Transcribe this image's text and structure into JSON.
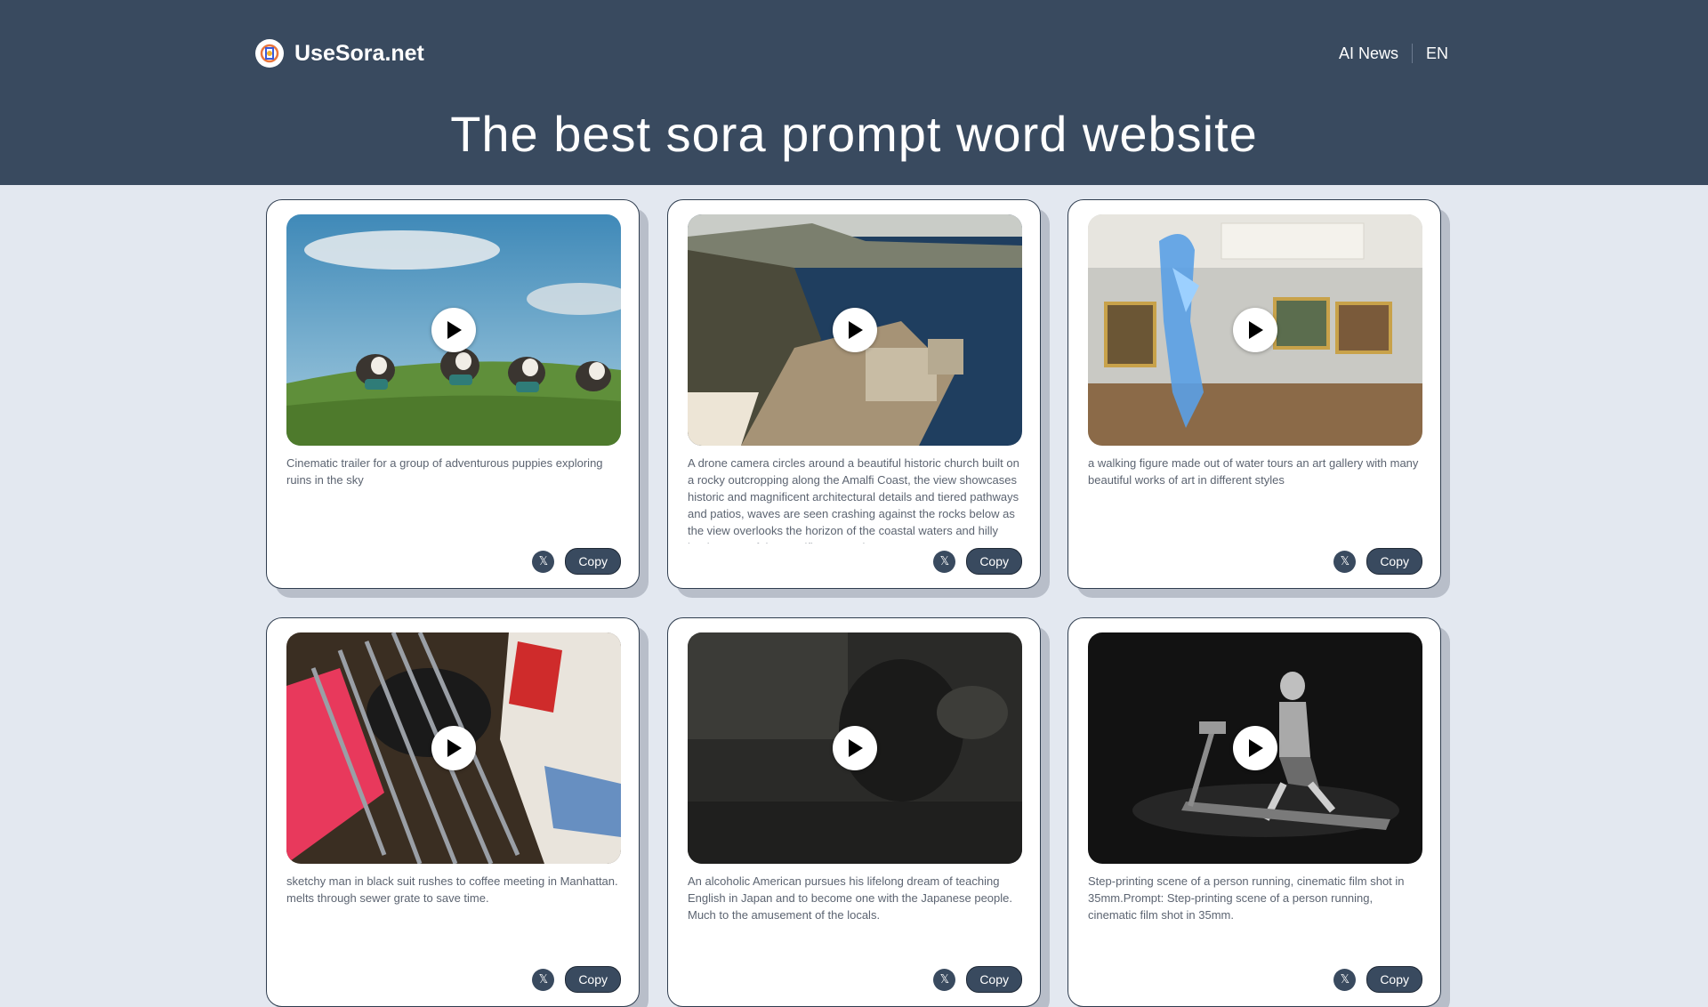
{
  "site": {
    "name": "UseSora.net"
  },
  "nav": {
    "items": [
      "AI News",
      "EN"
    ]
  },
  "hero": {
    "title": "The best sora prompt word website"
  },
  "colors": {
    "header_bg": "#394a5f",
    "page_bg": "#e3e8f0",
    "button_bg": "#394a5f"
  },
  "icons": {
    "logo": "usesora-logo-icon",
    "play": "play-icon",
    "x": "x-logo-icon"
  },
  "cards": [
    {
      "description": "Cinematic trailer for a group of adventurous puppies exploring ruins in the sky",
      "share_label": "𝕏",
      "copy_label": "Copy"
    },
    {
      "description": "A drone camera circles around a beautiful historic church built on a rocky outcropping along the Amalfi Coast, the view showcases historic and magnificent architectural details and tiered pathways and patios, waves are seen crashing against the rocks below as the view overlooks the horizon of the coastal waters and hilly landscapes of the Amalfi Coast Italy",
      "share_label": "𝕏",
      "copy_label": "Copy"
    },
    {
      "description": "a walking figure made out of water tours an art gallery with many beautiful works of art in different styles",
      "share_label": "𝕏",
      "copy_label": "Copy"
    },
    {
      "description": "sketchy man in black suit rushes to coffee meeting in Manhattan. melts through sewer grate to save time.",
      "share_label": "𝕏",
      "copy_label": "Copy"
    },
    {
      "description": "An alcoholic American pursues his lifelong dream of teaching English in Japan and to become one with the Japanese people. Much to the amusement of the locals.",
      "share_label": "𝕏",
      "copy_label": "Copy"
    },
    {
      "description": "Step-printing scene of a person running, cinematic film shot in 35mm.Prompt: Step-printing scene of a person running, cinematic film shot in 35mm.",
      "share_label": "𝕏",
      "copy_label": "Copy"
    }
  ]
}
